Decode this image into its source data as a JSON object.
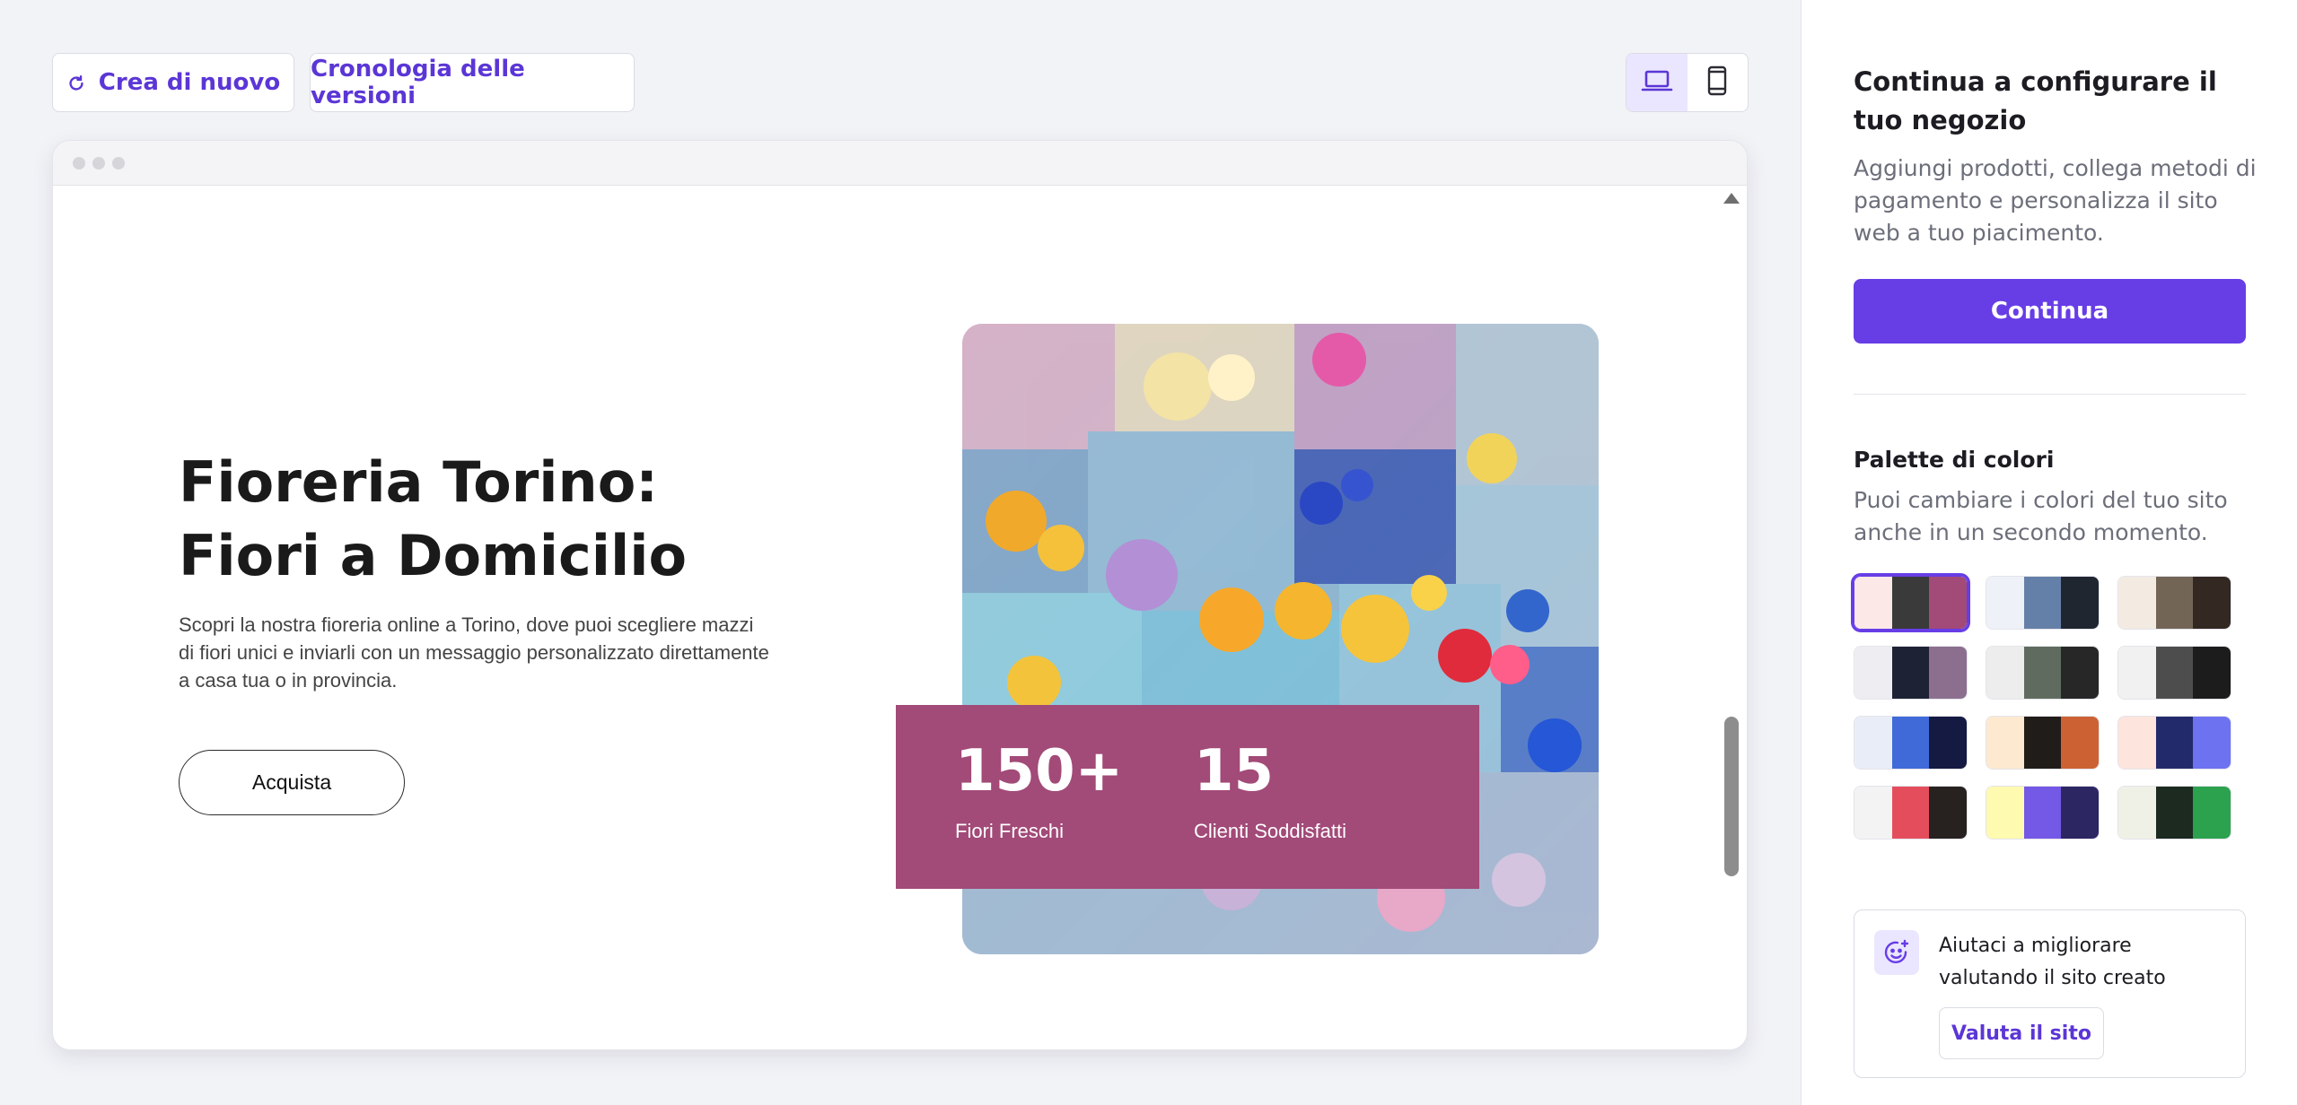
{
  "toolbar": {
    "regenerate_label": "Crea di nuovo",
    "history_label": "Cronologia delle versioni",
    "device_options": [
      "desktop",
      "mobile"
    ],
    "active_device": "desktop"
  },
  "preview": {
    "hero": {
      "title": "Fioreria Torino: Fiori a Domicilio",
      "description": "Scopri la nostra fioreria online a Torino, dove puoi scegliere mazzi di fiori unici e inviarli con un messaggio personalizzato direttamente a casa tua o in provincia.",
      "cta_label": "Acquista",
      "image": "flower-market-bouquets-photo"
    },
    "stats": [
      {
        "value": "150+",
        "label": "Fiori Freschi"
      },
      {
        "value": "15",
        "label": "Clienti Soddisfatti"
      }
    ],
    "accent_color": "#a24a78"
  },
  "side_panel": {
    "title": "Continua a configurare il tuo negozio",
    "subtitle": "Aggiungi prodotti, collega metodi di pagamento e personalizza il sito web a tuo piacimento.",
    "continue_label": "Continua",
    "palette_title": "Palette di colori",
    "palette_subtitle": "Puoi cambiare i colori del tuo sito anche in un secondo momento.",
    "selected_palette": 0,
    "palettes": [
      [
        "#fde8e8",
        "#3a3a3a",
        "#a24a78"
      ],
      [
        "#eef1f8",
        "#6580a8",
        "#1f2630"
      ],
      [
        "#f3ebe2",
        "#736556",
        "#332822"
      ],
      [
        "#eeeef2",
        "#1e2235",
        "#8c6f8f"
      ],
      [
        "#ededed",
        "#5f6b5e",
        "#272727"
      ],
      [
        "#f1f1f1",
        "#4d4d4d",
        "#1c1c1c"
      ],
      [
        "#e9edf7",
        "#3f6ad8",
        "#141a42"
      ],
      [
        "#fde9cf",
        "#201c19",
        "#cc6233"
      ],
      [
        "#fde4dc",
        "#232a6b",
        "#6d72f0"
      ],
      [
        "#f3f3f3",
        "#e44e5c",
        "#272220"
      ],
      [
        "#fefab0",
        "#7458e6",
        "#2c2663"
      ],
      [
        "#f0f1e6",
        "#1c2a20",
        "#2ca24f"
      ]
    ],
    "rating": {
      "text": "Aiutaci a migliorare valutando il sito creato",
      "button_label": "Valuta il sito"
    },
    "brand_color": "#673de6"
  }
}
